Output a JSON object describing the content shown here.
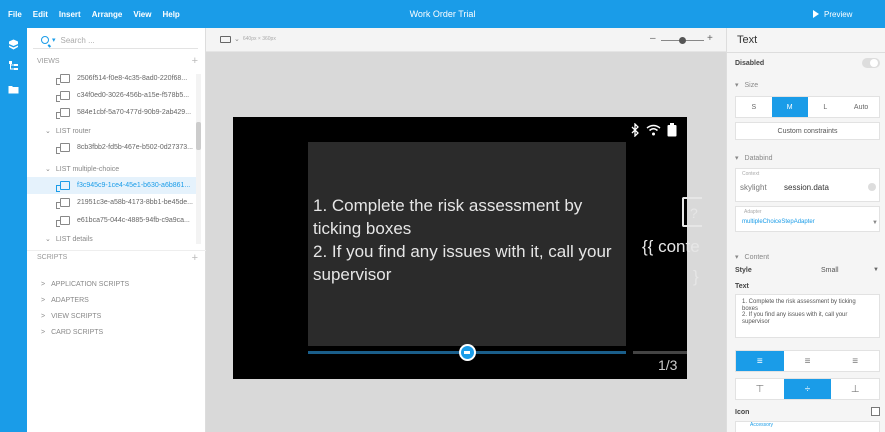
{
  "topbar": {
    "menu": [
      "File",
      "Edit",
      "Insert",
      "Arrange",
      "View",
      "Help"
    ],
    "title": "Work Order Trial",
    "preview_label": "Preview",
    "color": "#1a9ce8"
  },
  "rail": {
    "icons": [
      "workflow-icon",
      "tree-icon",
      "folder-icon"
    ]
  },
  "tree": {
    "search_placeholder": "Search ...",
    "views_label": "VIEWS",
    "rows_top": [
      "2506f514-f0e8-4c35-8ad0-220f68...",
      "c34f0ed0-3026-456b-a15e-f578b5...",
      "584e1cbf-5a70-477d-90b9-2ab429..."
    ],
    "group_router": "LIST  router",
    "row_router": "8cb3fbb2-fd5b-467e-b502-0d27373...",
    "group_mc": "LIST  multiple-choice",
    "row_mc_sel": "f3c945c9-1ce4-45e1-b630-a6b861...",
    "row_mc_2": "21951c3e-a58b-4173-8bb1-be45de...",
    "row_mc_3": "e61bca75-044c-4885-94fb-c9a9ca...",
    "group_details": "LIST  details",
    "scripts_label": "SCRIPTS",
    "script_items": [
      "APPLICATION SCRIPTS",
      "ADAPTERS",
      "VIEW SCRIPTS",
      "CARD SCRIPTS"
    ]
  },
  "canvas": {
    "device_resolution": "640px × 360px",
    "zoom_level": 0.5,
    "card_text": "1. Complete the risk assessment by ticking boxes\n2. If you find any issues with it, call your supervisor",
    "peek_text": "{{ conte",
    "peek_text2": "}",
    "peek_q": "?",
    "pager": "1/3",
    "progress": 0.5
  },
  "panel": {
    "title": "Text",
    "disabled_label": "Disabled",
    "disabled_on": false,
    "size_label": "Size",
    "sizes": [
      "S",
      "M",
      "L",
      "Auto"
    ],
    "size_selected": "M",
    "custom_constraints": "Custom constraints",
    "databind_label": "Databind",
    "context_small": "Context",
    "context_key": "skylight",
    "context_value": "session.data",
    "adapter_small": "Adapter",
    "adapter_value": "multipleChoiceStepAdapter",
    "content_label": "Content",
    "style_label": "Style",
    "style_value": "Small",
    "text_label": "Text",
    "text_value": "1. Complete the risk assessment by ticking boxes\n2. If you find any issues with it, call your supervisor",
    "icon_label": "Icon",
    "icon_small": "Accessory"
  }
}
